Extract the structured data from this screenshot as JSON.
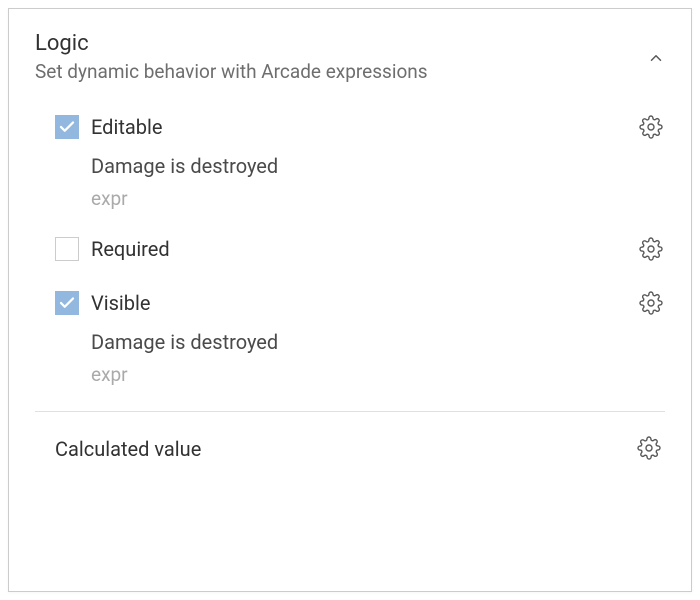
{
  "header": {
    "title": "Logic",
    "subtitle": "Set dynamic behavior with Arcade expressions"
  },
  "items": [
    {
      "label": "Editable",
      "checked": true,
      "detail": "Damage is destroyed",
      "expr": "expr"
    },
    {
      "label": "Required",
      "checked": false,
      "detail": "",
      "expr": ""
    },
    {
      "label": "Visible",
      "checked": true,
      "detail": "Damage is destroyed",
      "expr": "expr"
    }
  ],
  "calculated": {
    "label": "Calculated value"
  }
}
